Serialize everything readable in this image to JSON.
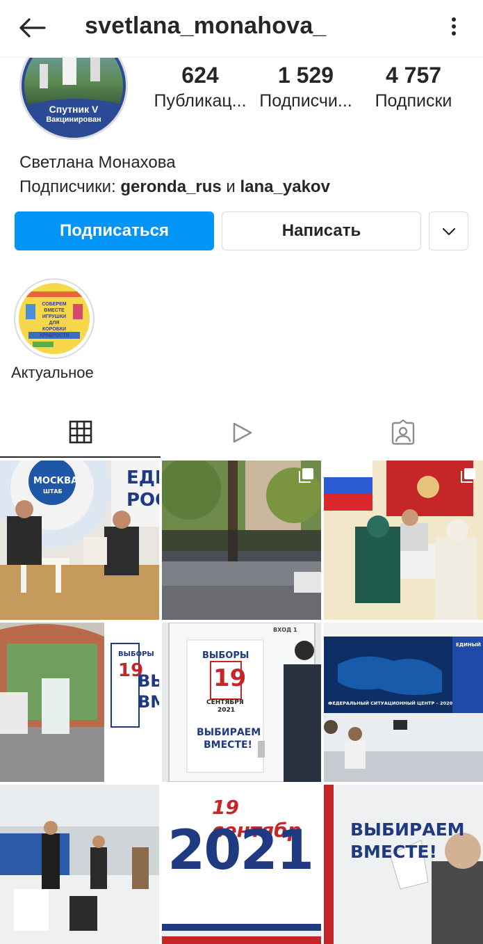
{
  "header": {
    "username": "svetlana_monahova_"
  },
  "avatar": {
    "badge_title": "Спутник V",
    "badge_subtitle": "Вакцинирован"
  },
  "stats": [
    {
      "value": "624",
      "label": "Публикац..."
    },
    {
      "value": "1 529",
      "label": "Подписчи..."
    },
    {
      "value": "4 757",
      "label": "Подписки"
    }
  ],
  "profile": {
    "full_name": "Светлана Монахова",
    "followers_prefix": "Подписчики:",
    "follower_1": "geronda_rus",
    "followers_and": "и",
    "follower_2": "lana_yakov"
  },
  "buttons": {
    "follow": "Подписаться",
    "message": "Написать"
  },
  "highlights": [
    {
      "label": "Актуальное",
      "img_text": "СОБЕРЕМ ВМЕСТЕ ИГРУШКИ ДЛЯ КОРОБКИ ХРАБРОСТИ"
    }
  ],
  "posts": {
    "p1": {
      "sign_1": "МОСКВА",
      "sign_2": "ШТАБ",
      "sign_3": "ЕДИ",
      "sign_4": "РОС"
    },
    "p4": {
      "sign_1": "ВЫБОРЫ",
      "sign_2": "19",
      "sign_3": "ВЫБИ",
      "sign_4": "ВМЕС"
    },
    "p5": {
      "sign_1": "ВЫБОРЫ",
      "sign_2": "19",
      "sign_3": "СЕНТЯБРЯ",
      "sign_4": "2021",
      "sign_5": "ВЫБИРАЕМ",
      "sign_6": "ВМЕСТЕ!",
      "sign_7": "ВХОД 1"
    },
    "p6": {
      "sign_1": "ФЕДЕРАЛЬНЫЙ СИТУАЦИОННЫЙ ЦЕНТР – 2020",
      "sign_2": "ЕДИНЫЙ"
    },
    "p8": {
      "sign_1": "19 сентябр",
      "sign_2": "2021"
    },
    "p9": {
      "sign_1": "ВЫБИРАЕМ",
      "sign_2": "ВМЕСТЕ!"
    }
  },
  "colors": {
    "accent": "#0095f6",
    "text": "#262626",
    "border": "#dbdbdb"
  }
}
